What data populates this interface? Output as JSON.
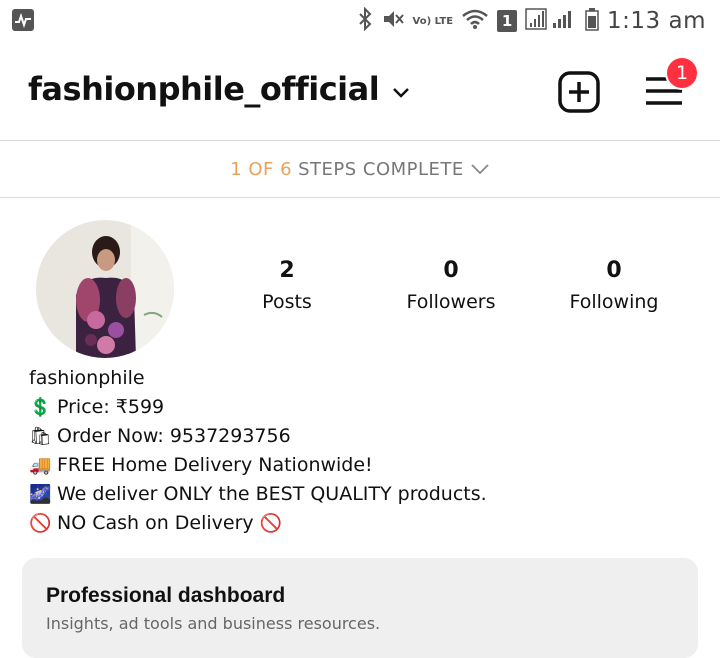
{
  "status_bar": {
    "time": "1:13 am",
    "sim_number": "1",
    "network_type": "Vo) LTE",
    "icons": [
      "activity-icon",
      "bluetooth-icon",
      "mute-icon",
      "volte-icon",
      "wifi-icon",
      "signal-icon",
      "battery-icon"
    ]
  },
  "header": {
    "username": "fashionphile_official",
    "notification_count": "1"
  },
  "steps": {
    "count": "1 OF 6",
    "label": "STEPS COMPLETE"
  },
  "profile": {
    "stats": [
      {
        "value": "2",
        "label": "Posts"
      },
      {
        "value": "0",
        "label": "Followers"
      },
      {
        "value": "0",
        "label": "Following"
      }
    ],
    "name": "fashionphile",
    "bio": [
      {
        "emoji": "💲",
        "text": "Price: ₹599"
      },
      {
        "emoji": "🛍",
        "text": "Order Now: 9537293756"
      },
      {
        "emoji": "🚚",
        "text": "FREE Home Delivery Nationwide!"
      },
      {
        "emoji": "🌌",
        "text": "We deliver ONLY the BEST QUALITY products."
      },
      {
        "emoji": "🚫",
        "text": "NO Cash on Delivery",
        "emoji_after": "🚫"
      }
    ]
  },
  "dashboard": {
    "title": "Professional dashboard",
    "subtitle": "Insights, ad tools and business resources."
  },
  "colors": {
    "badge": "#ff3040",
    "steps_accent": "#e8a25a",
    "divider": "#dbdbdb",
    "dashboard_bg": "#efefef"
  }
}
